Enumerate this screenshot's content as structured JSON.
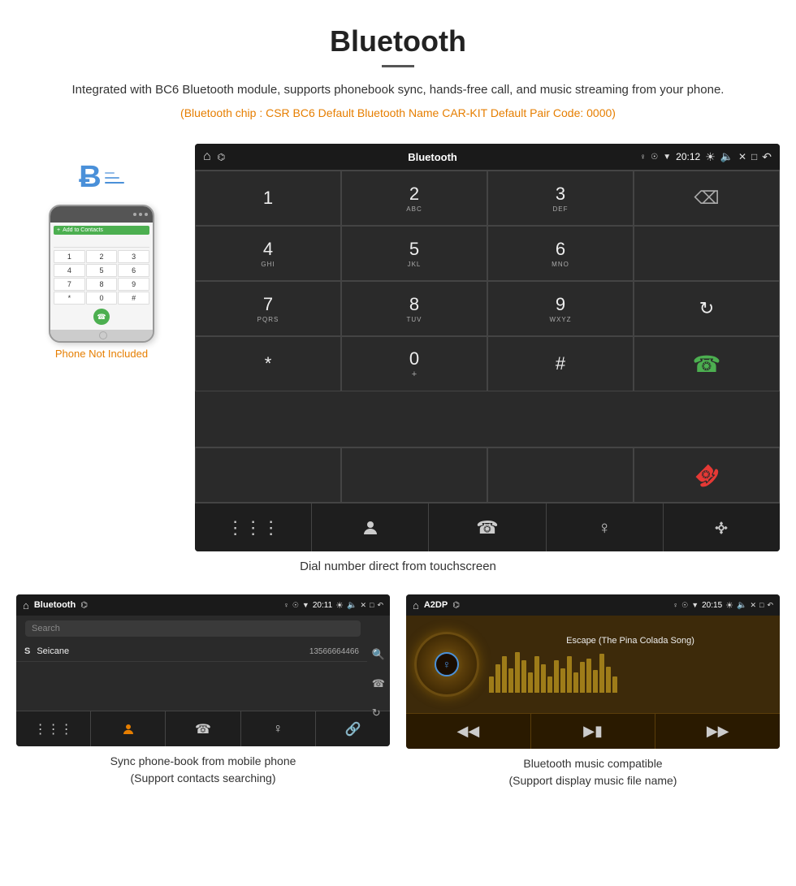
{
  "header": {
    "title": "Bluetooth",
    "description": "Integrated with BC6 Bluetooth module, supports phonebook sync, hands-free call, and music streaming from your phone.",
    "info_line": "(Bluetooth chip : CSR BC6    Default Bluetooth Name CAR-KIT    Default Pair Code: 0000)"
  },
  "car_screen": {
    "status_bar": {
      "app_name": "Bluetooth",
      "time": "20:12"
    },
    "dialpad": {
      "keys": [
        {
          "num": "1",
          "sub": ""
        },
        {
          "num": "2",
          "sub": "ABC"
        },
        {
          "num": "3",
          "sub": "DEF"
        },
        {
          "num": "",
          "sub": ""
        },
        {
          "num": "4",
          "sub": "GHI"
        },
        {
          "num": "5",
          "sub": "JKL"
        },
        {
          "num": "6",
          "sub": "MNO"
        },
        {
          "num": "",
          "sub": ""
        },
        {
          "num": "7",
          "sub": "PQRS"
        },
        {
          "num": "8",
          "sub": "TUV"
        },
        {
          "num": "9",
          "sub": "WXYZ"
        },
        {
          "num": "",
          "sub": "reload"
        },
        {
          "num": "*",
          "sub": ""
        },
        {
          "num": "0",
          "sub": "+"
        },
        {
          "num": "#",
          "sub": ""
        },
        {
          "num": "",
          "sub": "call_green"
        },
        {
          "num": "",
          "sub": "call_red"
        }
      ]
    }
  },
  "caption_main": "Dial number direct from touchscreen",
  "phone_not_included": "Phone Not Included",
  "phone_mockup": {
    "keys": [
      "1",
      "2",
      "3",
      "4",
      "5",
      "6",
      "7",
      "8",
      "9",
      "*",
      "0",
      "#"
    ]
  },
  "phonebook_screen": {
    "status": {
      "app_name": "Bluetooth",
      "time": "20:11"
    },
    "search_placeholder": "Search",
    "contact": {
      "letter": "S",
      "name": "Seicane",
      "number": "13566664466"
    }
  },
  "music_screen": {
    "status": {
      "app_name": "A2DP",
      "time": "20:15"
    },
    "song_name": "Escape (The Pina Colada Song)",
    "eq_bars": [
      20,
      35,
      45,
      30,
      50,
      40,
      25,
      45,
      35,
      20,
      40,
      30,
      45,
      25,
      38,
      42,
      28,
      48,
      32,
      20
    ]
  },
  "caption_phonebook": "Sync phone-book from mobile phone\n(Support contacts searching)",
  "caption_music": "Bluetooth music compatible\n(Support display music file name)"
}
